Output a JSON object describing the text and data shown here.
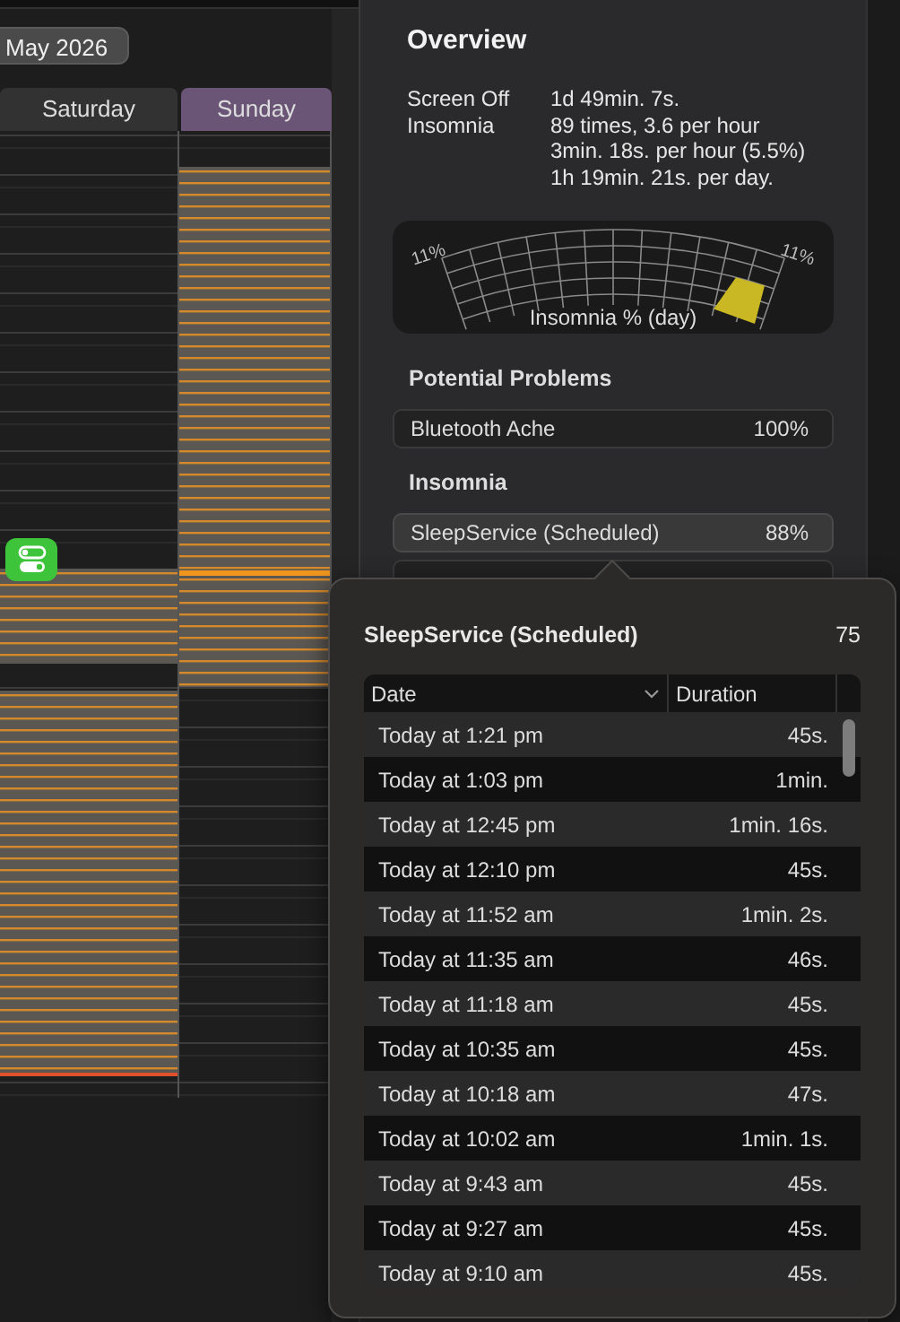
{
  "calendar": {
    "month_button": "May 2026",
    "days": [
      {
        "label": "Saturday",
        "selected": false
      },
      {
        "label": "Sunday",
        "selected": true
      }
    ]
  },
  "overview": {
    "title": "Overview",
    "stats": [
      {
        "label": "Screen Off",
        "values": [
          "1d 49min. 7s."
        ]
      },
      {
        "label": "Insomnia",
        "values": [
          "89 times, 3.6 per hour",
          "3min. 18s. per hour (5.5%)",
          "1h 19min. 21s. per day."
        ]
      }
    ],
    "gauge": {
      "min_label": "11%",
      "max_label": "11%",
      "caption": "Insomnia % (day)"
    }
  },
  "potential_problems": {
    "title": "Potential Problems",
    "items": [
      {
        "name": "Bluetooth Ache",
        "value": "100%"
      }
    ]
  },
  "insomnia": {
    "title": "Insomnia",
    "items": [
      {
        "name": "SleepService (Scheduled)",
        "value": "88%",
        "selected": true
      }
    ]
  },
  "popover": {
    "title": "SleepService (Scheduled)",
    "count": "75",
    "columns": [
      {
        "label": "Date",
        "sorted": true
      },
      {
        "label": "Duration",
        "sorted": false
      }
    ],
    "rows": [
      [
        "Today at 1:21 pm",
        "45s."
      ],
      [
        "Today at 1:03 pm",
        "1min."
      ],
      [
        "Today at 12:45 pm",
        "1min. 16s."
      ],
      [
        "Today at 12:10 pm",
        "45s."
      ],
      [
        "Today at 11:52 am",
        "1min. 2s."
      ],
      [
        "Today at 11:35 am",
        "46s."
      ],
      [
        "Today at 11:18 am",
        "45s."
      ],
      [
        "Today at 10:35 am",
        "45s."
      ],
      [
        "Today at 10:18 am",
        "47s."
      ],
      [
        "Today at 10:02 am",
        "1min. 1s."
      ],
      [
        "Today at 9:43 am",
        "45s."
      ],
      [
        "Today at 9:27 am",
        "45s."
      ],
      [
        "Today at 9:10 am",
        "45s."
      ]
    ]
  }
}
